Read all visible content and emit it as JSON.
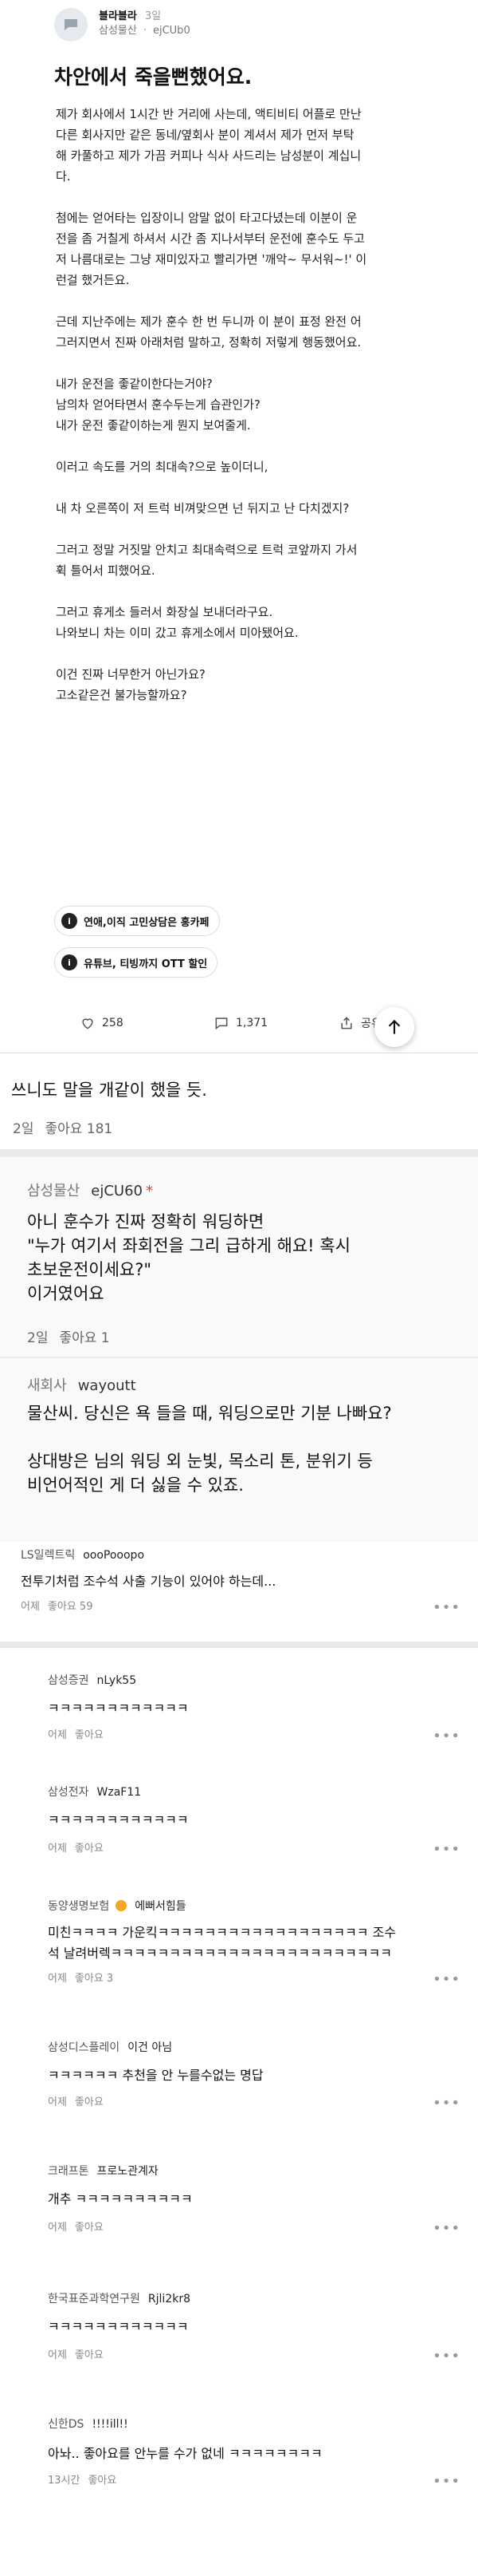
{
  "post": {
    "source": "블라블라",
    "time": "3일",
    "company": "삼성물산",
    "nickname": "ejCUb0",
    "title": "차안에서 죽을뻔했어요.",
    "body": "제가 회사에서 1시간 반 거리에 사는데, 액티비티 어플로 만난\n다른 회사지만 같은 동네/옆회사 분이 계셔서 제가 먼저 부탁\n해 카풀하고 제가 가끔 커피나 식사 사드리는 남성분이 계십니\n다.\n\n첨에는 얻어타는 입장이니 암말 없이 타고다녔는데 이분이 운\n전을 좀 거칠게 하셔서 시간 좀 지나서부터 운전에 훈수도 두고\n저 나름대로는 그냥 재미있자고 빨리가면 '깨악~ 무서워~!' 이\n런걸 했거든요.\n\n근데 지난주에는 제가 훈수 한 번 두니까 이 분이 표정 완전 어\n그러지면서 진짜 아래처럼 말하고, 정확히 저렇게 행동했어요.\n\n내가 운전을 좋같이한다는거야?\n남의차 얻어타면서 훈수두는게 습관인가?\n내가 운전 좋같이하는게 뭔지 보여줄게.\n\n이러고 속도를 거의 최대속?으로 높이더니,\n\n내 차 오른쪽이 저 트럭 비껴맞으면 넌 뒤지고 난 다치겠지?\n\n그러고 정말 거짓말 안치고 최대속력으로 트럭 코앞까지 가서\n휙 틀어서 피했어요.\n\n그러고 휴게소 들러서 화장실 보내더라구요.\n나와보니 차는 이미 갔고 휴게소에서 미아됐어요.\n\n이건 진짜 너무한거 아닌가요?\n고소같은건 불가능할까요?",
    "tags": [
      "연애,이직 고민상담은 홍카페",
      "유튜브, 티빙까지 OTT 할인"
    ],
    "likes": "258",
    "comments": "1,371",
    "share": "공유"
  },
  "comment_main": {
    "text": "쓰니도 말을 개같이 했을 듯.",
    "time": "2일",
    "like_label": "좋아요 181"
  },
  "reply_1": {
    "company": "삼성물산",
    "nickname": "ejCU60",
    "star": "*",
    "text": "아니 훈수가 진짜 정확히 워딩하면\n\"누가 여기서 좌회전을 그리 급하게 해요! 혹시\n초보운전이세요?\"\n이거였어요",
    "time": "2일",
    "like_label": "좋아요 1"
  },
  "reply_2": {
    "company": "새회사",
    "nickname": "wayoutt",
    "text": "물산씨. 당신은 욕 들을 때, 워딩으로만 기분 나빠요?\n\n상대방은 님의 워딩 외 눈빛, 목소리 톤, 분위기 등\n비언어적인 게 더 싫을 수 있죠.",
    "time": ""
  },
  "small_comments": [
    {
      "company": "LS일렉트릭",
      "nickname": "oooPooopo",
      "text": "전투기처럼 조수석 사출 기능이 있어야 하는데...",
      "time": "어제",
      "like_label": "좋아요 59"
    },
    {
      "company": "삼성증권",
      "nickname": "nLyk55",
      "text": "ㅋㅋㅋㅋㅋㅋㅋㅋㅋㅋㅋㅋ",
      "time": "어제",
      "like_label": "좋아요"
    },
    {
      "company": "삼성전자",
      "nickname": "WzaF11",
      "text": "ㅋㅋㅋㅋㅋㅋㅋㅋㅋㅋㅋㅋ",
      "time": "어제",
      "like_label": "좋아요"
    },
    {
      "company": "동양생명보험",
      "nickname": "에뻐서힘들",
      "text": "미친ㅋㅋㅋㅋ 가운킥ㅋㅋㅋㅋㅋㅋㅋㅋㅋㅋㅋㅋㅋㅋㅋㅋㅋㅋ 조수",
      "text2": "석 날려버렉ㅋㅋㅋㅋㅋㅋㅋㅋㅋㅋㅋㅋㅋㅋㅋㅋㅋㅋㅋㅋㅋㅋㅋㅋ",
      "time": "어제",
      "like_label": "좋아요 3"
    },
    {
      "company": "삼성디스플레이",
      "nickname": "이건 아님",
      "text": "ㅋㅋㅋㅋㅋㅋ 추천을 안 누를수없는 명답",
      "time": "어제",
      "like_label": "좋아요"
    },
    {
      "company": "크래프톤",
      "nickname": "프로노관계자",
      "text": "개추 ㅋㅋㅋㅋㅋㅋㅋㅋㅋㅋ",
      "time": "어제",
      "like_label": "좋아요"
    },
    {
      "company": "한국표준과학연구원",
      "nickname": "Rjli2kr8",
      "text": "ㅋㅋㅋㅋㅋㅋㅋㅋㅋㅋㅋㅋ",
      "time": "어제",
      "like_label": "좋아요"
    },
    {
      "company": "신한DS",
      "nickname": "!!!!ill!!",
      "text": "아놔.. 좋아요를 안누를 수가 없네 ㅋㅋㅋㅋㅋㅋㅋㅋ",
      "time": "13시간",
      "like_label": "좋아요"
    }
  ],
  "icons": {
    "more": "more-icon",
    "like": "heart-icon",
    "comment": "comment-icon",
    "share": "share-icon",
    "top": "arrow-up-icon",
    "badge": "badge-icon"
  }
}
